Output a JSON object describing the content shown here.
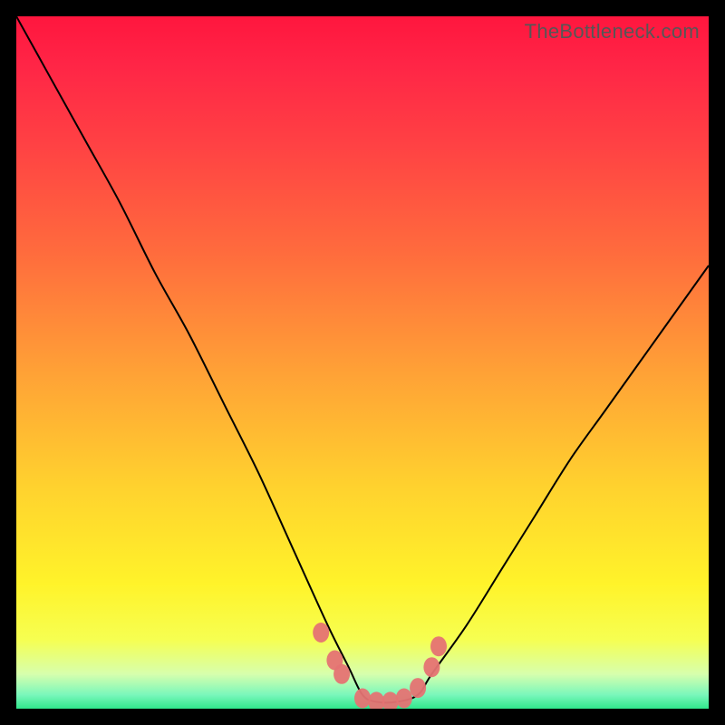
{
  "watermark": "TheBottleneck.com",
  "chart_data": {
    "type": "line",
    "title": "",
    "xlabel": "",
    "ylabel": "",
    "xlim": [
      0,
      100
    ],
    "ylim": [
      0,
      100
    ],
    "grid": false,
    "legend": false,
    "series": [
      {
        "name": "bottleneck-curve",
        "x": [
          0,
          5,
          10,
          15,
          20,
          25,
          30,
          35,
          40,
          45,
          48,
          50,
          52,
          55,
          58,
          60,
          65,
          70,
          75,
          80,
          85,
          90,
          95,
          100
        ],
        "values": [
          100,
          91,
          82,
          73,
          63,
          54,
          44,
          34,
          23,
          12,
          6,
          2,
          1,
          1,
          2,
          5,
          12,
          20,
          28,
          36,
          43,
          50,
          57,
          64
        ]
      }
    ],
    "markers": [
      {
        "name": "left-cluster",
        "x": 44,
        "y": 11
      },
      {
        "name": "left-cluster",
        "x": 46,
        "y": 7
      },
      {
        "name": "left-cluster",
        "x": 47,
        "y": 5
      },
      {
        "name": "trough",
        "x": 50,
        "y": 1.5
      },
      {
        "name": "trough",
        "x": 52,
        "y": 1
      },
      {
        "name": "trough",
        "x": 54,
        "y": 1
      },
      {
        "name": "trough",
        "x": 56,
        "y": 1.5
      },
      {
        "name": "right-cluster",
        "x": 58,
        "y": 3
      },
      {
        "name": "right-cluster",
        "x": 60,
        "y": 6
      },
      {
        "name": "right-cluster",
        "x": 61,
        "y": 9
      }
    ],
    "background_gradient_stops": [
      {
        "pos": 0.0,
        "color": "#ff163e"
      },
      {
        "pos": 0.34,
        "color": "#ff6b3d"
      },
      {
        "pos": 0.68,
        "color": "#ffd22e"
      },
      {
        "pos": 0.9,
        "color": "#f6ff51"
      },
      {
        "pos": 1.0,
        "color": "#30e88c"
      }
    ]
  }
}
